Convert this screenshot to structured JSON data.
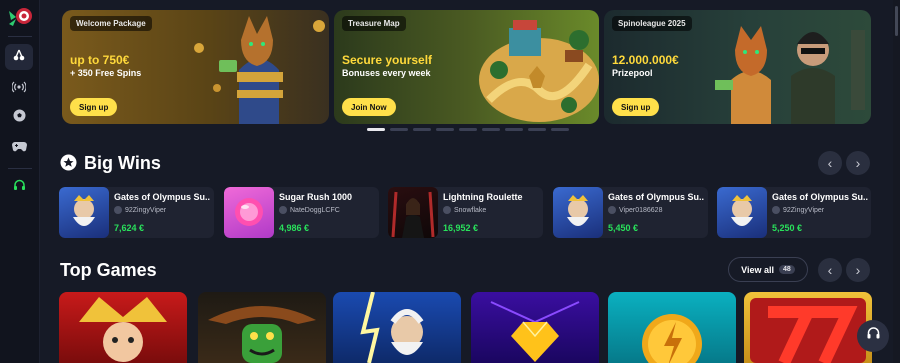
{
  "banners": [
    {
      "tag": "Welcome Package",
      "headline": "up to 750€",
      "subline": "+ 350 Free Spins",
      "cta": "Sign up"
    },
    {
      "tag": "Treasure Map",
      "headline": "Secure yourself",
      "subline": "Bonuses every week",
      "cta": "Join Now"
    },
    {
      "tag": "Spinoleague 2025",
      "headline": "12.000.000€",
      "subline": "Prizepool",
      "cta": "Sign up"
    }
  ],
  "big_wins": {
    "title": "Big Wins",
    "items": [
      {
        "game": "Gates of Olympus Su...",
        "user": "92ZingyViper",
        "amount": "7,624 €"
      },
      {
        "game": "Sugar Rush 1000",
        "user": "NateDoggLCFC",
        "amount": "4,986 €"
      },
      {
        "game": "Lightning Roulette",
        "user": "Snowflake",
        "amount": "16,952 €"
      },
      {
        "game": "Gates of Olympus Su...",
        "user": "Viper0186628",
        "amount": "5,450 €"
      },
      {
        "game": "Gates of Olympus Su...",
        "user": "92ZingyViper",
        "amount": "5,250 €"
      }
    ]
  },
  "top_games": {
    "title": "Top Games",
    "view_all": "View all",
    "count": "48"
  },
  "arrows": {
    "prev": "‹",
    "next": "›"
  },
  "colors": {
    "accent_yellow": "#ffe04a",
    "win_green": "#29e05b",
    "bg": "#161a26"
  },
  "icons": [
    "logo-icon",
    "cherries-icon",
    "live-icon",
    "soccer-icon",
    "gamepad-icon",
    "headset-icon",
    "star-icon",
    "user-icon"
  ]
}
